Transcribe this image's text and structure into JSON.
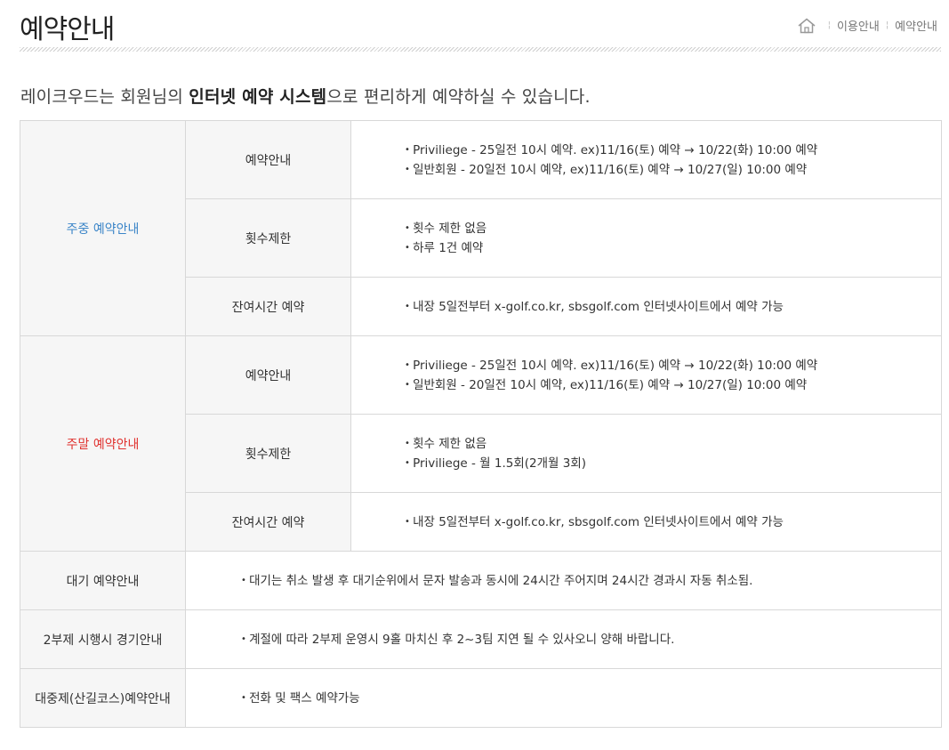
{
  "header": {
    "title": "예약안내",
    "breadcrumb": [
      "이용안내",
      "예약안내"
    ]
  },
  "intro": {
    "before": "레이크우드는 회원님의 ",
    "bold": "인터넷 예약 시스템",
    "after": "으로 편리하게 예약하실 수 있습니다."
  },
  "colors": {
    "weekday": "#3b85c8",
    "weekend": "#e0322f"
  },
  "weekday": {
    "label": "주중 예약안내",
    "rows": [
      {
        "label": "예약안내",
        "lines": [
          "Priviliege - 25일전 10시 예약. ex)11/16(토) 예약 → 10/22(화) 10:00 예약",
          "일반회원 - 20일전 10시 예약, ex)11/16(토) 예약 → 10/27(일) 10:00 예약"
        ]
      },
      {
        "label": "횟수제한",
        "lines": [
          "횟수 제한 없음",
          "하루 1건 예약"
        ]
      },
      {
        "label": "잔여시간 예약",
        "lines": [
          "내장 5일전부터 x-golf.co.kr, sbsgolf.com 인터넷사이트에서 예약 가능"
        ]
      }
    ]
  },
  "weekend": {
    "label": "주말 예약안내",
    "rows": [
      {
        "label": "예약안내",
        "lines": [
          "Priviliege - 25일전 10시 예약. ex)11/16(토) 예약 → 10/22(화) 10:00 예약",
          "일반회원 - 20일전 10시 예약, ex)11/16(토) 예약 → 10/27(일) 10:00 예약"
        ]
      },
      {
        "label": "횟수제한",
        "lines": [
          "횟수 제한 없음",
          "Priviliege - 월 1.5회(2개월 3회)"
        ]
      },
      {
        "label": "잔여시간 예약",
        "lines": [
          "내장 5일전부터 x-golf.co.kr, sbsgolf.com 인터넷사이트에서 예약 가능"
        ]
      }
    ]
  },
  "extra": [
    {
      "label": "대기 예약안내",
      "text": "대기는 취소 발생 후 대기순위에서 문자 발송과 동시에 24시간 주어지며 24시간 경과시 자동 취소됨."
    },
    {
      "label": "2부제 시행시 경기안내",
      "text": "계절에 따라 2부제 운영시 9홀 마치신 후 2~3팀 지연 될 수 있사오니 양해 바랍니다."
    },
    {
      "label": "대중제(산길코스)예약안내",
      "text": "전화 및 팩스 예약가능"
    }
  ]
}
